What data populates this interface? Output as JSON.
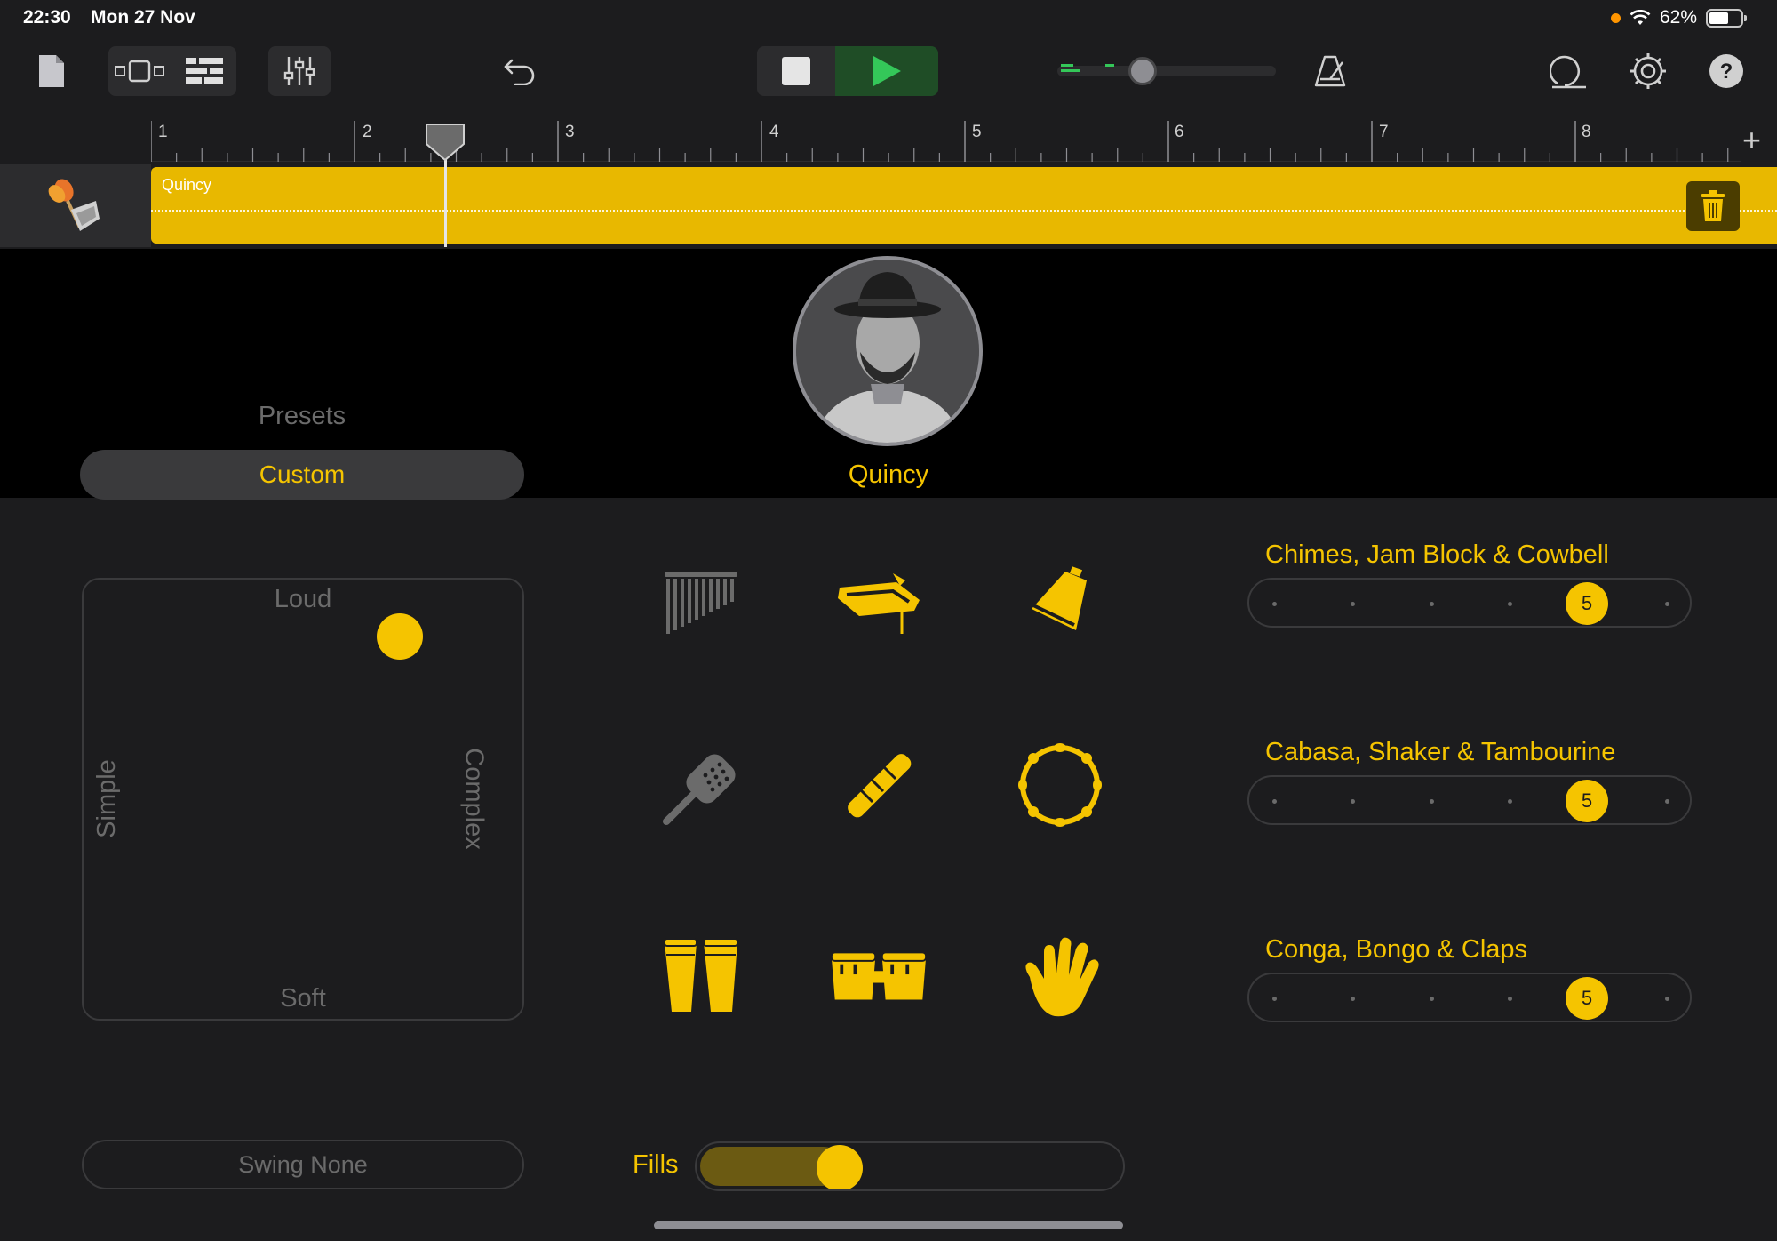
{
  "status_bar": {
    "time": "22:30",
    "date": "Mon 27 Nov",
    "battery": "62%",
    "battery_level": 0.62
  },
  "toolbar": {
    "icons": [
      "my-songs-icon",
      "browser-view-icon",
      "tracks-view-icon",
      "mixer-icon",
      "undo-icon",
      "stop-icon",
      "play-icon",
      "master-volume-icon",
      "metronome-icon",
      "loop-browser-icon",
      "settings-icon",
      "help-icon"
    ]
  },
  "ruler": {
    "bars": [
      "1",
      "2",
      "3",
      "4",
      "5",
      "6",
      "7",
      "8"
    ],
    "add_label": "+"
  },
  "track": {
    "region_name": "Quincy"
  },
  "drummer": {
    "presets_label": "Presets",
    "preset_value": "Custom",
    "name": "Quincy"
  },
  "xy_pad": {
    "top": "Loud",
    "bottom": "Soft",
    "left": "Simple",
    "right": "Complex",
    "puck_complexity": 0.72,
    "puck_loudness": 0.87
  },
  "instrument_groups": [
    {
      "label": "Chimes, Jam Block & Cowbell",
      "value": "5",
      "level": 4
    },
    {
      "label": "Cabasa, Shaker & Tambourine",
      "value": "5",
      "level": 4
    },
    {
      "label": "Conga, Bongo & Claps",
      "value": "5",
      "level": 4
    }
  ],
  "swing": {
    "label": "Swing None"
  },
  "fills": {
    "label": "Fills",
    "level": 0.33
  },
  "colors": {
    "accent": "#f5c400",
    "region": "#e8b800",
    "play": "#34c759"
  }
}
